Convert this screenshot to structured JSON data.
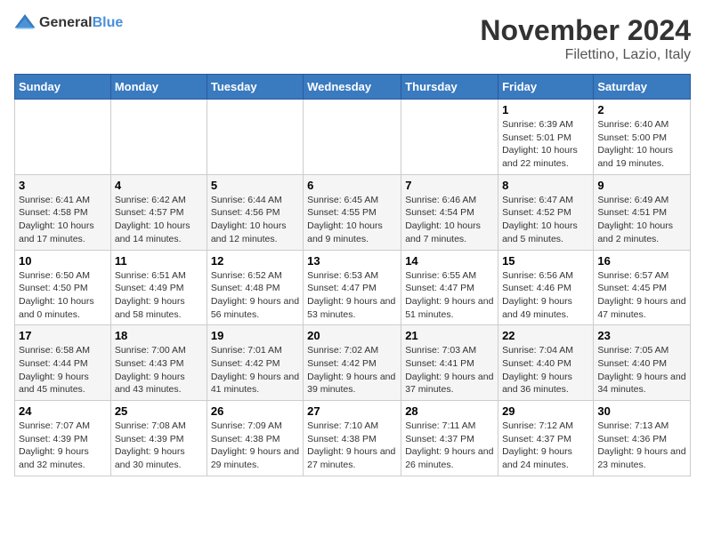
{
  "logo": {
    "general": "General",
    "blue": "Blue"
  },
  "title": "November 2024",
  "location": "Filettino, Lazio, Italy",
  "weekdays": [
    "Sunday",
    "Monday",
    "Tuesday",
    "Wednesday",
    "Thursday",
    "Friday",
    "Saturday"
  ],
  "weeks": [
    [
      {
        "day": "",
        "info": ""
      },
      {
        "day": "",
        "info": ""
      },
      {
        "day": "",
        "info": ""
      },
      {
        "day": "",
        "info": ""
      },
      {
        "day": "",
        "info": ""
      },
      {
        "day": "1",
        "info": "Sunrise: 6:39 AM\nSunset: 5:01 PM\nDaylight: 10 hours and 22 minutes."
      },
      {
        "day": "2",
        "info": "Sunrise: 6:40 AM\nSunset: 5:00 PM\nDaylight: 10 hours and 19 minutes."
      }
    ],
    [
      {
        "day": "3",
        "info": "Sunrise: 6:41 AM\nSunset: 4:58 PM\nDaylight: 10 hours and 17 minutes."
      },
      {
        "day": "4",
        "info": "Sunrise: 6:42 AM\nSunset: 4:57 PM\nDaylight: 10 hours and 14 minutes."
      },
      {
        "day": "5",
        "info": "Sunrise: 6:44 AM\nSunset: 4:56 PM\nDaylight: 10 hours and 12 minutes."
      },
      {
        "day": "6",
        "info": "Sunrise: 6:45 AM\nSunset: 4:55 PM\nDaylight: 10 hours and 9 minutes."
      },
      {
        "day": "7",
        "info": "Sunrise: 6:46 AM\nSunset: 4:54 PM\nDaylight: 10 hours and 7 minutes."
      },
      {
        "day": "8",
        "info": "Sunrise: 6:47 AM\nSunset: 4:52 PM\nDaylight: 10 hours and 5 minutes."
      },
      {
        "day": "9",
        "info": "Sunrise: 6:49 AM\nSunset: 4:51 PM\nDaylight: 10 hours and 2 minutes."
      }
    ],
    [
      {
        "day": "10",
        "info": "Sunrise: 6:50 AM\nSunset: 4:50 PM\nDaylight: 10 hours and 0 minutes."
      },
      {
        "day": "11",
        "info": "Sunrise: 6:51 AM\nSunset: 4:49 PM\nDaylight: 9 hours and 58 minutes."
      },
      {
        "day": "12",
        "info": "Sunrise: 6:52 AM\nSunset: 4:48 PM\nDaylight: 9 hours and 56 minutes."
      },
      {
        "day": "13",
        "info": "Sunrise: 6:53 AM\nSunset: 4:47 PM\nDaylight: 9 hours and 53 minutes."
      },
      {
        "day": "14",
        "info": "Sunrise: 6:55 AM\nSunset: 4:47 PM\nDaylight: 9 hours and 51 minutes."
      },
      {
        "day": "15",
        "info": "Sunrise: 6:56 AM\nSunset: 4:46 PM\nDaylight: 9 hours and 49 minutes."
      },
      {
        "day": "16",
        "info": "Sunrise: 6:57 AM\nSunset: 4:45 PM\nDaylight: 9 hours and 47 minutes."
      }
    ],
    [
      {
        "day": "17",
        "info": "Sunrise: 6:58 AM\nSunset: 4:44 PM\nDaylight: 9 hours and 45 minutes."
      },
      {
        "day": "18",
        "info": "Sunrise: 7:00 AM\nSunset: 4:43 PM\nDaylight: 9 hours and 43 minutes."
      },
      {
        "day": "19",
        "info": "Sunrise: 7:01 AM\nSunset: 4:42 PM\nDaylight: 9 hours and 41 minutes."
      },
      {
        "day": "20",
        "info": "Sunrise: 7:02 AM\nSunset: 4:42 PM\nDaylight: 9 hours and 39 minutes."
      },
      {
        "day": "21",
        "info": "Sunrise: 7:03 AM\nSunset: 4:41 PM\nDaylight: 9 hours and 37 minutes."
      },
      {
        "day": "22",
        "info": "Sunrise: 7:04 AM\nSunset: 4:40 PM\nDaylight: 9 hours and 36 minutes."
      },
      {
        "day": "23",
        "info": "Sunrise: 7:05 AM\nSunset: 4:40 PM\nDaylight: 9 hours and 34 minutes."
      }
    ],
    [
      {
        "day": "24",
        "info": "Sunrise: 7:07 AM\nSunset: 4:39 PM\nDaylight: 9 hours and 32 minutes."
      },
      {
        "day": "25",
        "info": "Sunrise: 7:08 AM\nSunset: 4:39 PM\nDaylight: 9 hours and 30 minutes."
      },
      {
        "day": "26",
        "info": "Sunrise: 7:09 AM\nSunset: 4:38 PM\nDaylight: 9 hours and 29 minutes."
      },
      {
        "day": "27",
        "info": "Sunrise: 7:10 AM\nSunset: 4:38 PM\nDaylight: 9 hours and 27 minutes."
      },
      {
        "day": "28",
        "info": "Sunrise: 7:11 AM\nSunset: 4:37 PM\nDaylight: 9 hours and 26 minutes."
      },
      {
        "day": "29",
        "info": "Sunrise: 7:12 AM\nSunset: 4:37 PM\nDaylight: 9 hours and 24 minutes."
      },
      {
        "day": "30",
        "info": "Sunrise: 7:13 AM\nSunset: 4:36 PM\nDaylight: 9 hours and 23 minutes."
      }
    ]
  ]
}
